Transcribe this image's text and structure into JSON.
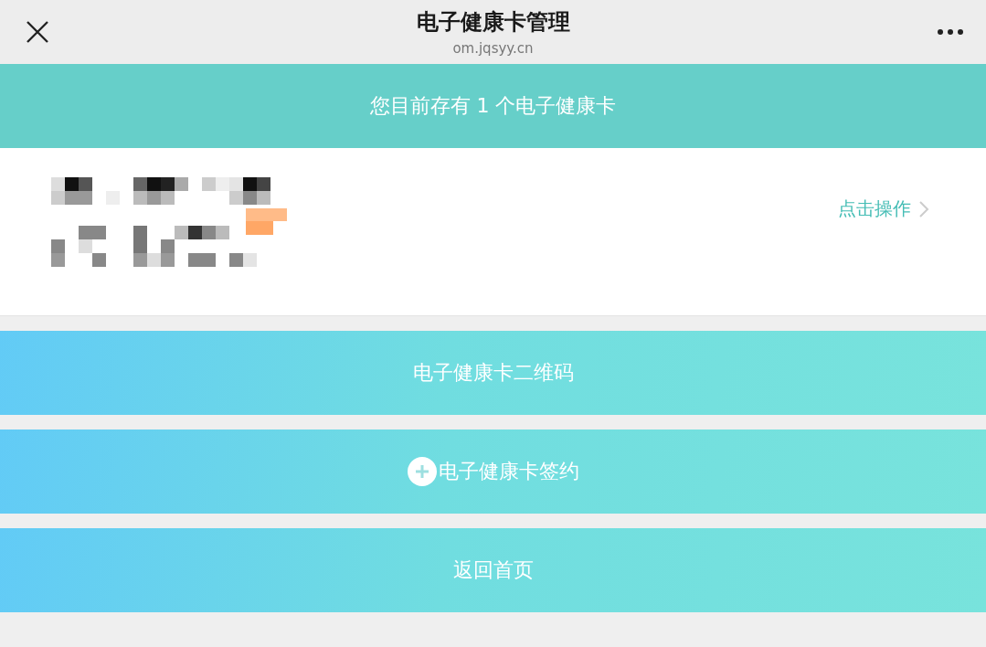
{
  "window": {
    "title": "电子健康卡管理",
    "url": "om.jqsyy.cn"
  },
  "banner": {
    "text": "您目前存有 1 个电子健康卡"
  },
  "card": {
    "action": "点击操作"
  },
  "buttons": [
    {
      "label": "电子健康卡二维码",
      "kind": "plain"
    },
    {
      "label": "电子健康卡签约",
      "kind": "add"
    },
    {
      "label": "返回首页",
      "kind": "plain"
    }
  ]
}
